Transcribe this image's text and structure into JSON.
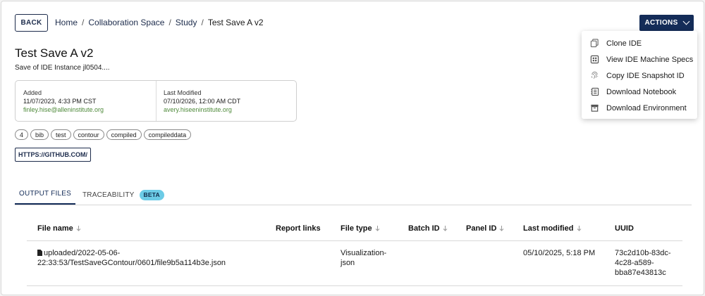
{
  "header": {
    "back_label": "BACK",
    "breadcrumb": [
      "Home",
      "Collaboration Space",
      "Study",
      "Test Save A v2"
    ],
    "actions_label": "ACTIONS"
  },
  "actions_menu": [
    {
      "label": "Clone IDE",
      "icon": "copy-icon"
    },
    {
      "label": "View IDE Machine Specs",
      "icon": "cpu-icon"
    },
    {
      "label": "Copy IDE Snapshot ID",
      "icon": "fingerprint-icon"
    },
    {
      "label": "Download Notebook",
      "icon": "notebook-icon"
    },
    {
      "label": "Download Environment",
      "icon": "archive-icon"
    }
  ],
  "project": {
    "title": "Test Save A v2",
    "subtitle": "Save of IDE Instance jl0504....",
    "added": {
      "label": "Added",
      "date": "11/07/2023, 4:33 PM CST",
      "email": "finley.hise@alleninstitute.org"
    },
    "modified": {
      "label": "Last Modified",
      "date": "07/10/2026, 12:00 AM CDT",
      "email": "avery.hiseeninstitute.org"
    },
    "tags": [
      "4",
      "bib",
      "test",
      "contour",
      "compiled",
      "compileddata"
    ],
    "link_label": "HTTPS://GITHUB.COM/"
  },
  "tabs": {
    "output": "OUTPUT FILES",
    "traceability": "TRACEABILITY",
    "beta": "BETA"
  },
  "table": {
    "columns": [
      "File name",
      "Report links",
      "File type",
      "Batch ID",
      "Panel ID",
      "Last modified",
      "UUID"
    ],
    "rows": [
      {
        "file_name_1": "uploaded/2022-05-06-",
        "file_name_2": "22:33:53/TestSaveGContour/0601/file9b5a114b3e.json",
        "report_links": "",
        "file_type_1": "Visualization-",
        "file_type_2": "json",
        "batch_id": "",
        "panel_id": "",
        "last_modified": "05/10/2025, 5:18 PM",
        "uuid_1": "73c2d10b-83dc-",
        "uuid_2": "4c28-a589-",
        "uuid_3": "bba87e43813c"
      }
    ]
  },
  "colors": {
    "primary": "#142c58",
    "beta_badge": "#6ccbe6",
    "email": "#4f8a3b"
  }
}
